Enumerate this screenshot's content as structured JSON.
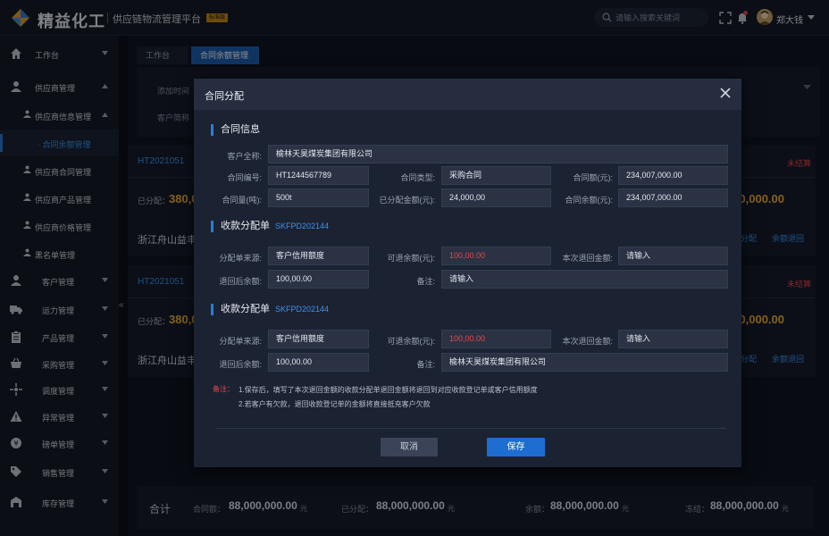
{
  "header": {
    "brand": "精益化工",
    "subtitle": "供应链物流管理平台",
    "version_badge": "标准版",
    "search_placeholder": "请输入搜索关键词",
    "username": "郑大钱"
  },
  "sidebar": {
    "items": [
      {
        "label": "工作台"
      },
      {
        "label": "供应商管理"
      },
      {
        "label": "供应商信息管理"
      },
      {
        "label": "合同余额管理"
      },
      {
        "label": "供应商合同管理"
      },
      {
        "label": "供应商产品管理"
      },
      {
        "label": "供应商价格管理"
      },
      {
        "label": "黑名单管理"
      },
      {
        "label": "客户管理"
      },
      {
        "label": "运力管理"
      },
      {
        "label": "产品管理"
      },
      {
        "label": "采购管理"
      },
      {
        "label": "调度管理"
      },
      {
        "label": "异常管理"
      },
      {
        "label": "磅单管理"
      },
      {
        "label": "销售管理"
      },
      {
        "label": "库存管理"
      }
    ],
    "collapse_glyph": "«"
  },
  "tabs": [
    {
      "label": "工作台"
    },
    {
      "label": "合同余额管理"
    }
  ],
  "filters": {
    "added_time_label": "添加时间",
    "customer_label": "客户简称"
  },
  "cards": [
    {
      "code": "HT2021051",
      "status": "未结算",
      "allocated_label": "已分配：",
      "allocated_value": "380,0",
      "right_value": "0,000.00",
      "company": "浙江舟山益丰",
      "link1": "分配",
      "link2": "余额退回"
    },
    {
      "code": "HT2021051",
      "status": "未结算",
      "allocated_label": "已分配：",
      "allocated_value": "380,0",
      "right_value": "0,000.00",
      "company": "浙江舟山益丰",
      "link1": "分配",
      "link2": "余额退回"
    }
  ],
  "summary": {
    "title": "合计",
    "items": [
      {
        "label": "合同额：",
        "value": "88,000,000.00",
        "unit": "元"
      },
      {
        "label": "已分配：",
        "value": "88,000,000.00",
        "unit": "元"
      },
      {
        "label": "余额：",
        "value": "88,000,000.00",
        "unit": "元"
      },
      {
        "label": "冻结：",
        "value": "88,000,000.00",
        "unit": "元"
      }
    ]
  },
  "modal": {
    "title": "合同分配",
    "contract": {
      "section_title": "合同信息",
      "customer_full_name_label": "客户全称:",
      "customer_full_name": "榆林天昊煤炭集团有限公司",
      "contract_no_label": "合同编号:",
      "contract_no": "HT1244567789",
      "contract_type_label": "合同类型:",
      "contract_type": "采购合同",
      "contract_amount_label": "合同额(元):",
      "contract_amount": "234,007,000.00",
      "contract_qty_label": "合同量(吨):",
      "contract_qty": "500t",
      "allocated_amount_label": "已分配金额(元):",
      "allocated_amount": "24,000,00",
      "contract_balance_label": "合同余额(元):",
      "contract_balance": "234,007,000.00"
    },
    "receipts": [
      {
        "section_title": "收款分配单",
        "code": "SKFPD202144",
        "source_label": "分配单来源:",
        "source": "客户信用额度",
        "refundable_label": "可退余额(元):",
        "refundable": "100,00.00",
        "return_amount_label": "本次退回金额:",
        "return_amount": "请输入",
        "after_balance_label": "退回后余额:",
        "after_balance": "100,00.00",
        "remark_label": "备注:",
        "remark": "请输入"
      },
      {
        "section_title": "收款分配单",
        "code": "SKFPD202144",
        "source_label": "分配单来源:",
        "source": "客户信用额度",
        "refundable_label": "可退余额(元):",
        "refundable": "100,00.00",
        "return_amount_label": "本次退回金额:",
        "return_amount": "请输入",
        "after_balance_label": "退回后余额:",
        "after_balance": "100,00.00",
        "remark_label": "备注:",
        "remark": "榆林天昊煤炭集团有限公司"
      }
    ],
    "note_label": "备注：",
    "note_lines": [
      "1.保存后，填写了本次退回金额的收款分配单退回金额将退回到对应收款登记单或客户信用额度",
      "2.若客户有欠款，退回收款登记单的金额将直接抵充客户欠款"
    ],
    "cancel_label": "取消",
    "save_label": "保存"
  },
  "colors": {
    "accent": "#2a7bd6",
    "warning": "#f2b33b",
    "danger": "#e5484d",
    "background": "#0f1522"
  }
}
